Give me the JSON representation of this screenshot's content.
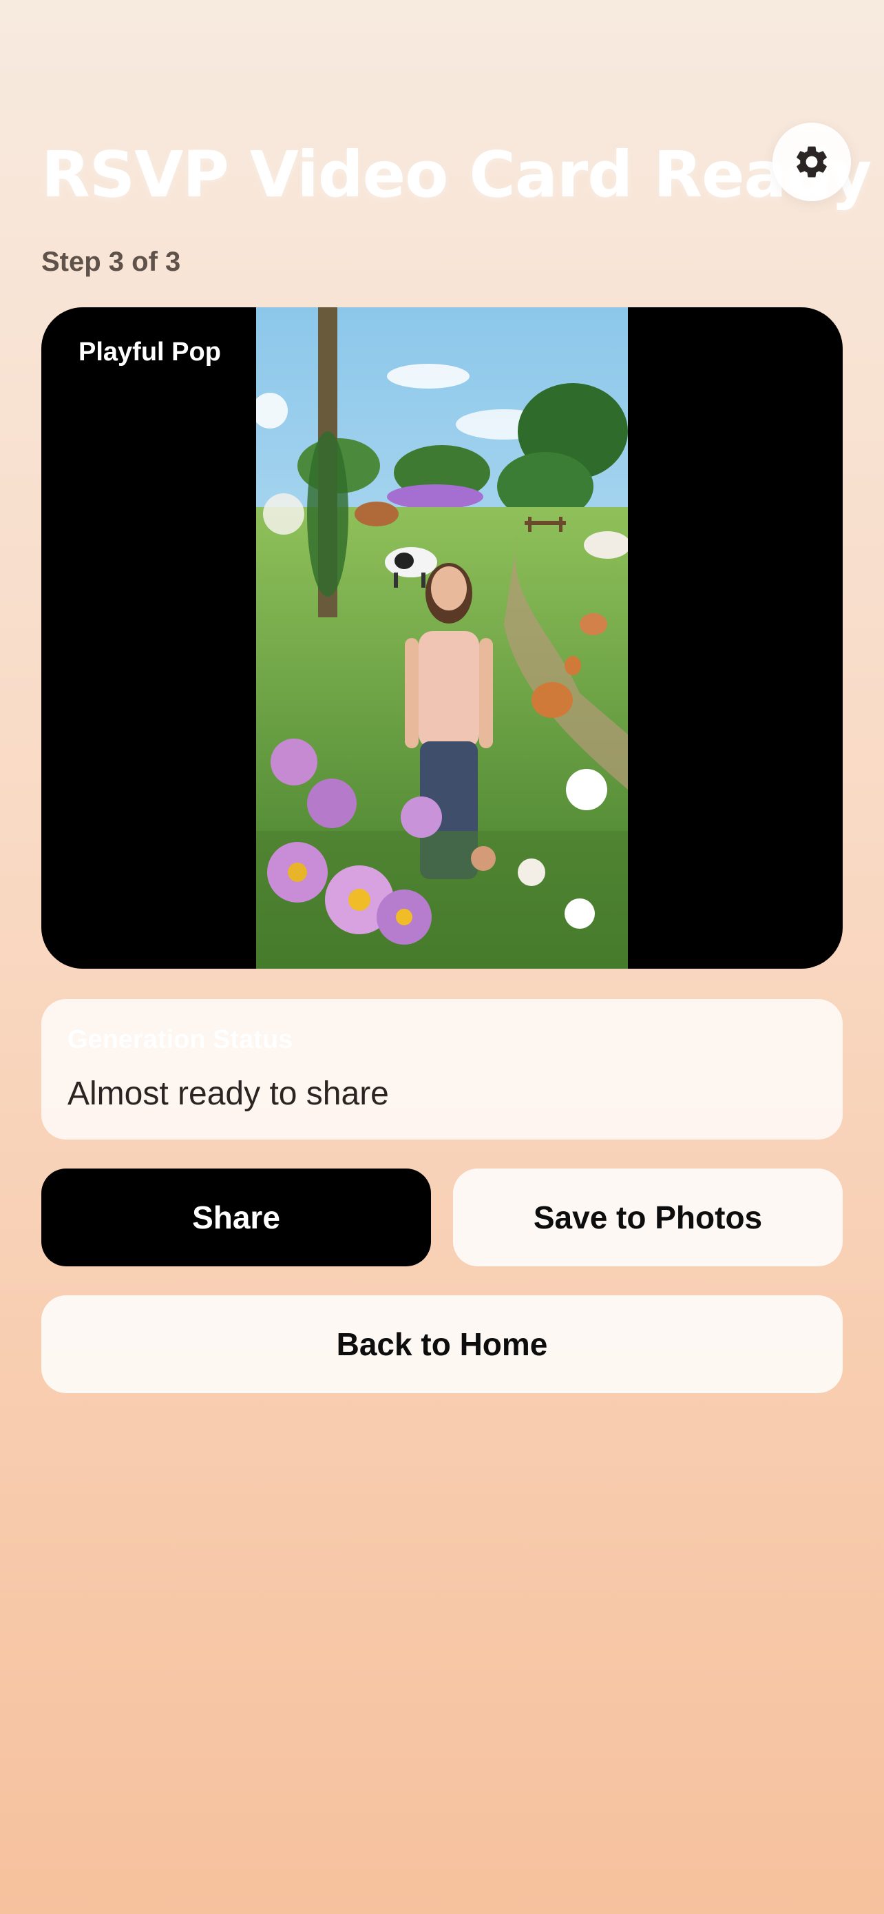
{
  "header": {
    "title": "RSVP Video Card Ready",
    "step": "Step 3 of 3",
    "settings_icon": "gear-icon"
  },
  "video": {
    "style_label": "Playful Pop",
    "scene": "woman smiling in a flower garden with farm animals"
  },
  "status": {
    "heading": "Generation Status",
    "message": "Almost ready to share"
  },
  "actions": {
    "share_label": "Share",
    "save_label": "Save to Photos",
    "home_label": "Back to Home"
  },
  "colors": {
    "accent": "#000000",
    "background_top": "#f7eadf",
    "background_bottom": "#f6c19d"
  }
}
